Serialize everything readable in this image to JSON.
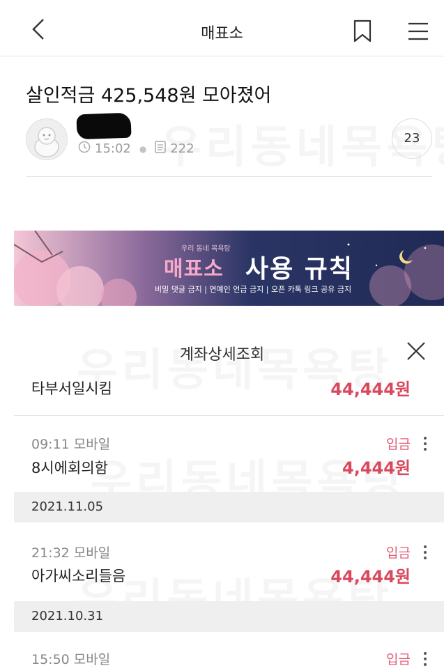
{
  "header": {
    "title": "매표소"
  },
  "post": {
    "title": "살인적금 425,548원 모아졌어",
    "time": "15:02",
    "views": "222",
    "comment_count": "23"
  },
  "banner": {
    "subtitle": "우리 동네 목욕탕",
    "title_pink": "매표소",
    "title_white": "사용 규칙",
    "rules": "비밀 댓글 금지 | 연예인 언급 금지 | 오픈 카톡 링크 공유 금지"
  },
  "sheet": {
    "title": "계좌상세조회",
    "rows": [
      {
        "name": "타부서일시킴",
        "amount": "44,444원"
      },
      {
        "time": "09:11 모바일",
        "type": "입금",
        "name": "8시에회의함",
        "amount": "4,444원"
      },
      {
        "date": "2021.11.05"
      },
      {
        "time": "21:32 모바일",
        "type": "입금",
        "name": "아가씨소리들음",
        "amount": "44,444원"
      },
      {
        "date": "2021.10.31"
      },
      {
        "time": "15:50 모바일",
        "type": "입금"
      }
    ]
  },
  "watermark": "우리동네목욕탕",
  "colors": {
    "amount": "#d9485d",
    "deposit": "#e0607a",
    "banner_bg": "#2a3565"
  }
}
